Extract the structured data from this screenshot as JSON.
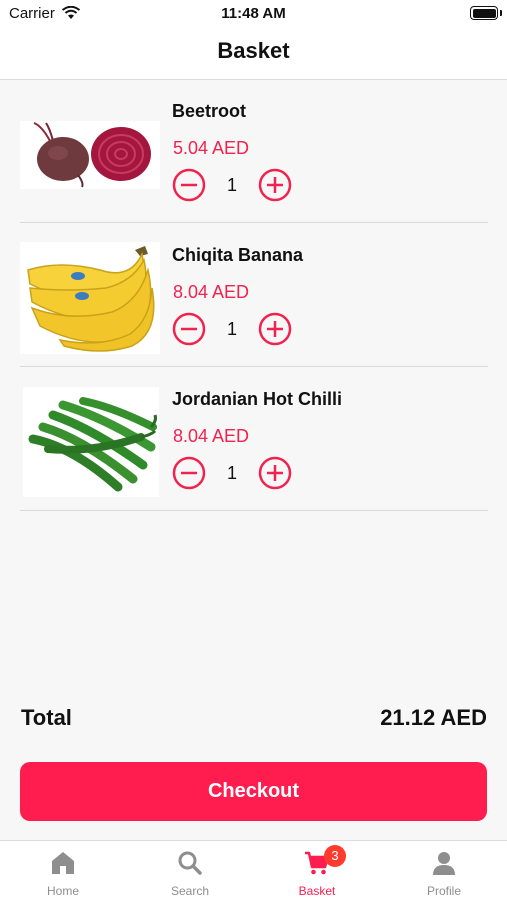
{
  "status_bar": {
    "carrier": "Carrier",
    "time": "11:48 AM"
  },
  "nav": {
    "title": "Basket"
  },
  "basket": {
    "items": [
      {
        "name": "Beetroot",
        "price": "5.04 AED",
        "quantity": "1",
        "image": "beetroot-photo"
      },
      {
        "name": "Chiqita Banana",
        "price": "8.04 AED",
        "quantity": "1",
        "image": "banana-photo"
      },
      {
        "name": "Jordanian Hot Chilli",
        "price": "8.04 AED",
        "quantity": "1",
        "image": "chilli-photo"
      }
    ]
  },
  "total": {
    "label": "Total",
    "value": "21.12 AED"
  },
  "checkout": {
    "label": "Checkout"
  },
  "tabs": [
    {
      "label": "Home",
      "icon": "home-icon",
      "active": false
    },
    {
      "label": "Search",
      "icon": "search-icon",
      "active": false
    },
    {
      "label": "Basket",
      "icon": "cart-icon",
      "active": true,
      "badge": "3"
    },
    {
      "label": "Profile",
      "icon": "person-icon",
      "active": false
    }
  ],
  "colors": {
    "accent": "#ff1c4f",
    "price": "#f0234e",
    "badge": "#ff3b30",
    "inactive_tab": "#8e8e8e"
  }
}
